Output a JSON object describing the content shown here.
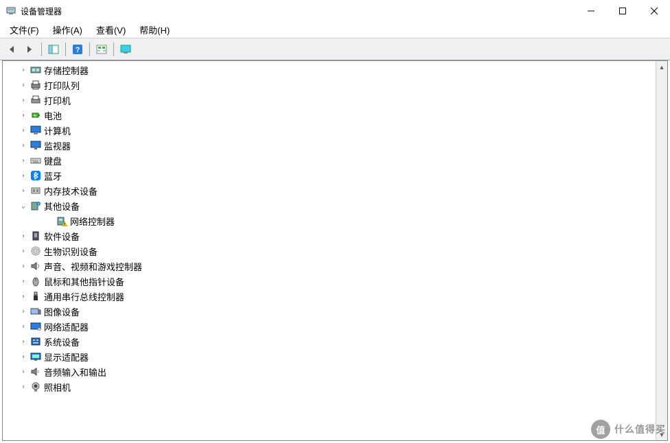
{
  "window": {
    "title": "设备管理器"
  },
  "menu": {
    "file": "文件(F)",
    "action": "操作(A)",
    "view": "查看(V)",
    "help": "帮助(H)"
  },
  "tree": {
    "items": [
      {
        "icon": "storage-controller-icon",
        "label": "存储控制器",
        "expanded": false
      },
      {
        "icon": "print-queue-icon",
        "label": "打印队列",
        "expanded": false
      },
      {
        "icon": "printer-icon",
        "label": "打印机",
        "expanded": false
      },
      {
        "icon": "battery-icon",
        "label": "电池",
        "expanded": false
      },
      {
        "icon": "computer-icon",
        "label": "计算机",
        "expanded": false
      },
      {
        "icon": "monitor-icon",
        "label": "监视器",
        "expanded": false
      },
      {
        "icon": "keyboard-icon",
        "label": "键盘",
        "expanded": false
      },
      {
        "icon": "bluetooth-icon",
        "label": "蓝牙",
        "expanded": false
      },
      {
        "icon": "memory-icon",
        "label": "内存技术设备",
        "expanded": false
      },
      {
        "icon": "other-devices-icon",
        "label": "其他设备",
        "expanded": true,
        "children": [
          {
            "icon": "unknown-device-icon",
            "label": "网络控制器",
            "warning": true
          }
        ]
      },
      {
        "icon": "software-device-icon",
        "label": "软件设备",
        "expanded": false
      },
      {
        "icon": "biometric-icon",
        "label": "生物识别设备",
        "expanded": false
      },
      {
        "icon": "sound-icon",
        "label": "声音、视频和游戏控制器",
        "expanded": false
      },
      {
        "icon": "mouse-icon",
        "label": "鼠标和其他指针设备",
        "expanded": false
      },
      {
        "icon": "usb-icon",
        "label": "通用串行总线控制器",
        "expanded": false
      },
      {
        "icon": "image-device-icon",
        "label": "图像设备",
        "expanded": false
      },
      {
        "icon": "network-adapter-icon",
        "label": "网络适配器",
        "expanded": false
      },
      {
        "icon": "system-device-icon",
        "label": "系统设备",
        "expanded": false
      },
      {
        "icon": "display-adapter-icon",
        "label": "显示适配器",
        "expanded": false
      },
      {
        "icon": "audio-io-icon",
        "label": "音频输入和输出",
        "expanded": false
      },
      {
        "icon": "camera-icon",
        "label": "照相机",
        "expanded": false
      }
    ]
  },
  "watermark": {
    "badge": "值",
    "text": "什么值得买"
  }
}
